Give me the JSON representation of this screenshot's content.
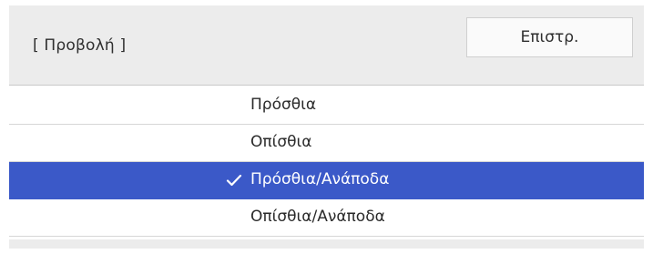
{
  "header": {
    "title": "[ Προβολή ]",
    "back_label": "Επιστρ."
  },
  "list": {
    "items": [
      {
        "label": "Πρόσθια",
        "selected": false
      },
      {
        "label": "Οπίσθια",
        "selected": false
      },
      {
        "label": "Πρόσθια/Ανάποδα",
        "selected": true,
        "icon": "check-icon"
      },
      {
        "label": "Οπίσθια/Ανάποδα",
        "selected": false
      }
    ]
  },
  "colors": {
    "header_bg": "#ececec",
    "selected_bg": "#3b59c8",
    "selected_text": "#ffffff"
  }
}
